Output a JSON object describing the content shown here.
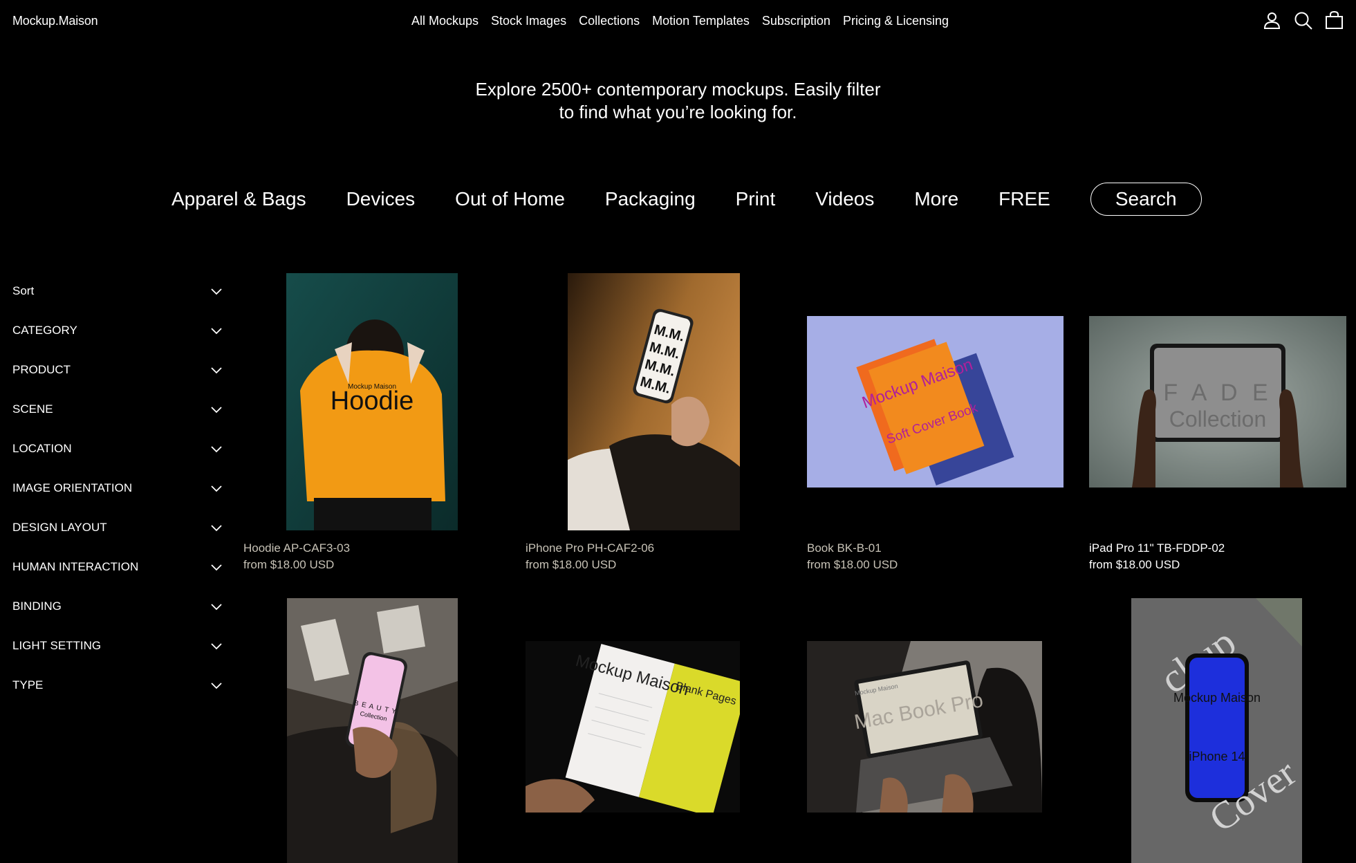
{
  "header": {
    "logo": "Mockup.Maison",
    "nav": [
      "All Mockups",
      "Stock Images",
      "Collections",
      "Motion Templates",
      "Subscription",
      "Pricing & Licensing"
    ],
    "icons": [
      "account-icon",
      "search-icon",
      "cart-icon"
    ]
  },
  "hero": {
    "line1": "Explore 2500+ contemporary mockups. Easily filter",
    "line2": "to find what you’re looking for."
  },
  "categories": [
    "Apparel & Bags",
    "Devices",
    "Out of Home",
    "Packaging",
    "Print",
    "Videos",
    "More",
    "FREE"
  ],
  "search_label": "Search",
  "filters": [
    "Sort",
    "CATEGORY",
    "PRODUCT",
    "SCENE",
    "LOCATION",
    "IMAGE ORIENTATION",
    "DESIGN LAYOUT",
    "HUMAN INTERACTION",
    "BINDING",
    "LIGHT SETTING",
    "TYPE"
  ],
  "products": [
    {
      "title": "Hoodie AP-CAF3-03",
      "price": "from $18.00 USD",
      "image_text": "Hoodie",
      "image_subtext": "Mockup Maison"
    },
    {
      "title": "iPhone Pro PH-CAF2-06",
      "price": "from $18.00 USD",
      "image_text": "M.M.",
      "image_subtext": ""
    },
    {
      "title": "Book BK-B-01",
      "price": "from $18.00 USD",
      "image_text": "Mockup Maison",
      "image_subtext": "Soft Cover Book"
    },
    {
      "title": "iPad Pro 11\" TB-FDDP-02",
      "price": "from $18.00 USD",
      "image_text": "F A D E",
      "image_subtext": "Collection"
    },
    {
      "image_text": "B E A U T Y",
      "image_subtext": "Collection"
    },
    {
      "image_text": "Mockup Maison",
      "image_subtext": "Blank Pages"
    },
    {
      "image_text": "Mac Book Pro",
      "image_subtext": "Mockup Maison"
    },
    {
      "image_text": "Mockup Maison",
      "image_subtext": "iPhone 14"
    }
  ],
  "colors": {
    "background": "#000000",
    "text": "#ffffff",
    "dim_text": "#c7c2b6",
    "hoodie": "#f29a14",
    "book": "#f28a1e",
    "book_text": "#b0209a",
    "phone_blue": "#1d2fdc"
  }
}
